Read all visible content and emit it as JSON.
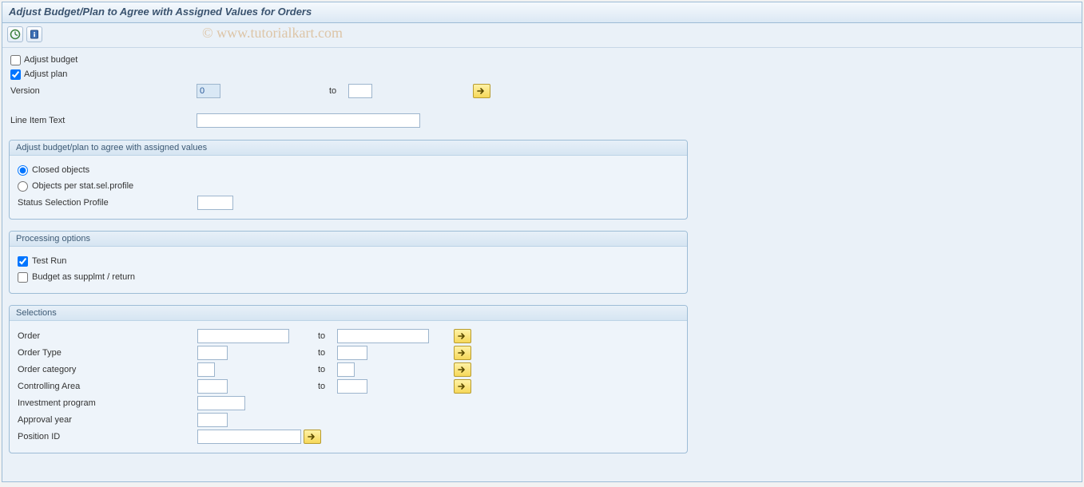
{
  "title": "Adjust Budget/Plan to Agree with Assigned Values for Orders",
  "watermark": "© www.tutorialkart.com",
  "top": {
    "adjust_budget": "Adjust budget",
    "adjust_plan": "Adjust plan",
    "version_label": "Version",
    "version_from": "0",
    "version_to_label": "to",
    "version_to": "",
    "line_item_text_label": "Line Item Text",
    "line_item_text": ""
  },
  "group1": {
    "title": "Adjust budget/plan to agree with assigned values",
    "closed_objects": "Closed objects",
    "objects_per_profile": "Objects per stat.sel.profile",
    "status_profile_label": "Status Selection Profile",
    "status_profile": ""
  },
  "group2": {
    "title": "Processing options",
    "test_run": "Test Run",
    "budget_supplmt": "Budget as supplmt / return"
  },
  "group3": {
    "title": "Selections",
    "to": "to",
    "rows": {
      "order": {
        "label": "Order"
      },
      "order_type": {
        "label": "Order Type"
      },
      "order_category": {
        "label": "Order category"
      },
      "controlling_area": {
        "label": "Controlling Area"
      },
      "invest_program": {
        "label": "Investment program"
      },
      "approval_year": {
        "label": "Approval year"
      },
      "position_id": {
        "label": "Position ID"
      }
    }
  }
}
